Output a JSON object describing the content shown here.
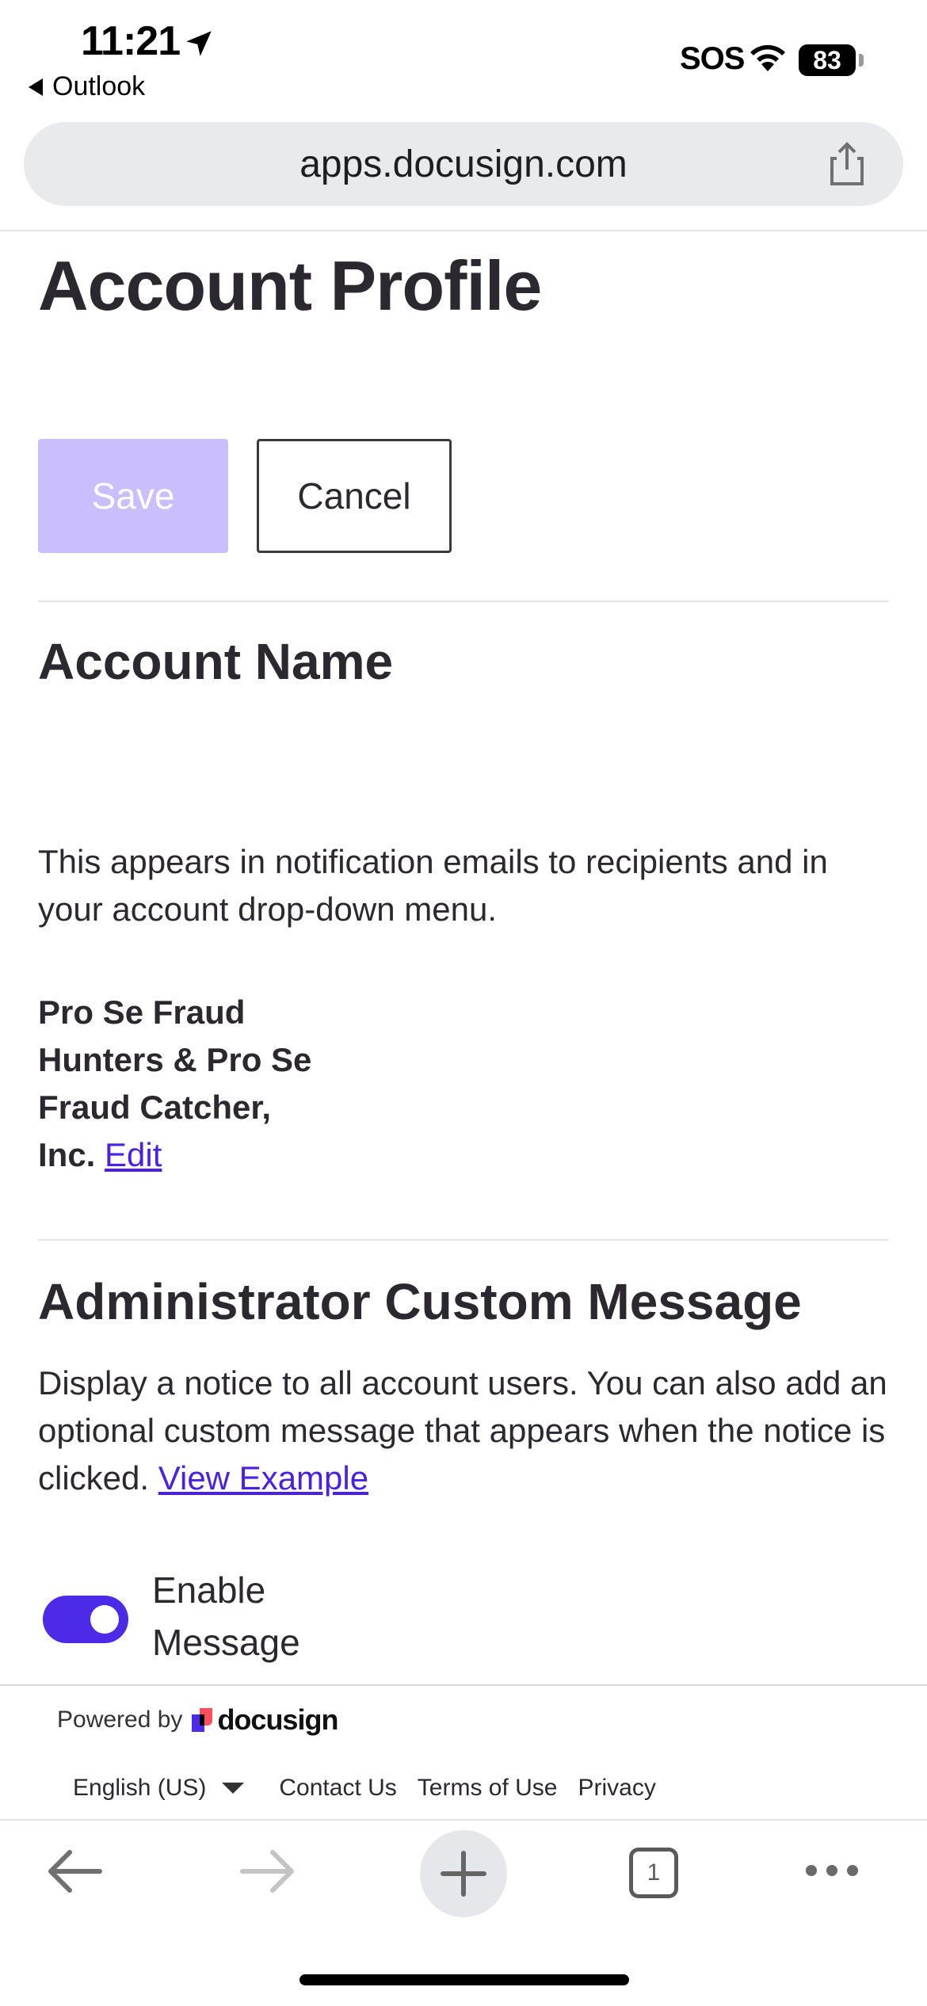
{
  "status_bar": {
    "time": "11:21",
    "back_app": "Outlook",
    "carrier": "SOS",
    "battery": "83"
  },
  "browser": {
    "url": "apps.docusign.com",
    "tab_count": "1"
  },
  "page": {
    "title": "Account Profile",
    "save_label": "Save",
    "cancel_label": "Cancel",
    "account_name": {
      "heading": "Account Name",
      "description": "This appears in notification emails to recipients and in your account drop-down menu.",
      "value_line1": "Pro Se Fraud",
      "value_line2": "Hunters & Pro Se",
      "value_line3": "Fraud Catcher,",
      "value_line4": "Inc.",
      "edit_label": "Edit"
    },
    "admin_message": {
      "heading": "Administrator Custom Message",
      "description": "Display a notice to all account users. You can also add an optional custom message that appears when the notice is clicked.",
      "view_example_label": "View Example",
      "toggle_label_line1": "Enable",
      "toggle_label_line2": "Message",
      "toggle_on": true
    }
  },
  "footer": {
    "powered_by": "Powered by",
    "brand": "docusign",
    "language": "English (US)",
    "links": [
      "Contact Us",
      "Terms of Use",
      "Privacy"
    ]
  },
  "colors": {
    "accent": "#4c2ae8",
    "save_disabled": "#cbbefe",
    "link": "#4a20e6",
    "text": "#2c2830"
  }
}
